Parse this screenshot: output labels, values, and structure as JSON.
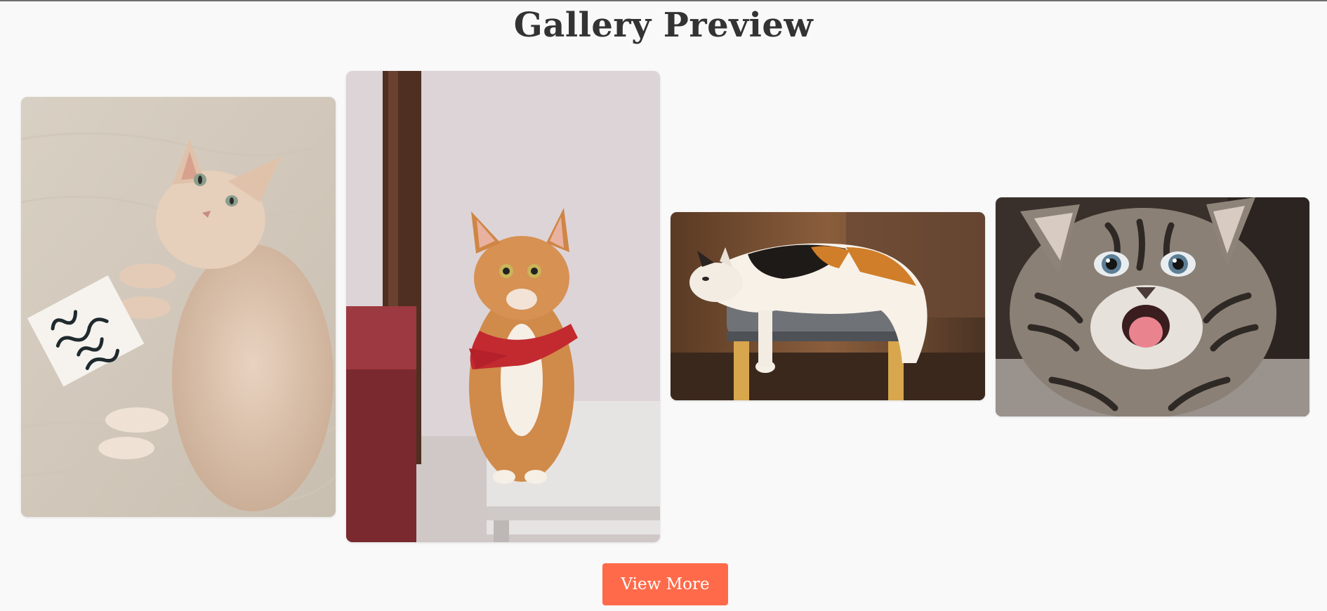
{
  "page": {
    "title": "Gallery Preview"
  },
  "gallery": {
    "images": [
      {
        "subject": "cream cat lying on blanket holding a card",
        "card_text": "all you need is cat"
      },
      {
        "subject": "orange and white cat with red bandana looking up"
      },
      {
        "subject": "calico cat lying on a stool"
      },
      {
        "subject": "tabby kitten with open mouth"
      }
    ]
  },
  "actions": {
    "view_more_label": "View More"
  },
  "colors": {
    "background": "#f9f9f9",
    "title": "#333333",
    "accent": "#ff6b4a"
  }
}
